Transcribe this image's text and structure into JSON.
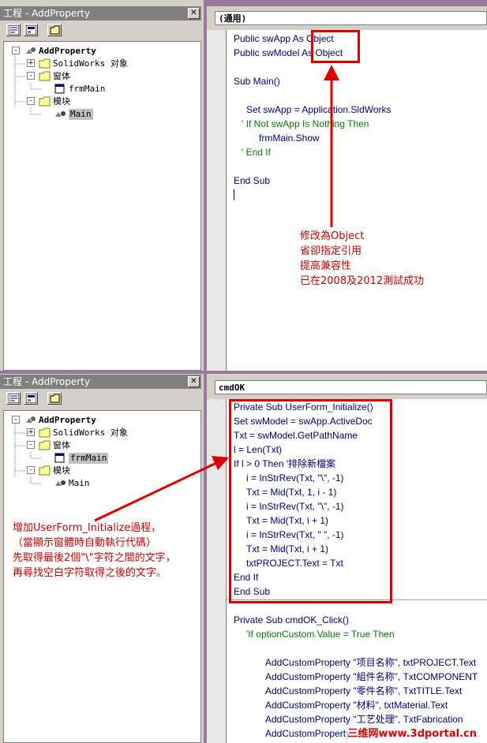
{
  "top": {
    "project_title": "工程 - AddProperty",
    "close_glyph": "✕",
    "combo": "(通用)",
    "tree": [
      {
        "label": "AddProperty",
        "bold": true
      },
      {
        "label": "SolidWorks 对象",
        "expander": "+"
      },
      {
        "label": "窗体",
        "expander": "-"
      },
      {
        "label": "frmMain"
      },
      {
        "label": "模块",
        "expander": "-"
      },
      {
        "label": "Main",
        "selected": true
      }
    ],
    "code": [
      "Public swApp As Object",
      "Public swModel As Object",
      "",
      "Sub Main()",
      "",
      "Set swApp = Application.SldWorks",
      "' If Not swApp Is Nothing Then",
      "frmMain.Show",
      "' End If",
      "",
      "End Sub"
    ],
    "annotation": [
      "修改為Object",
      "省卻指定引用",
      "提高兼容性",
      "已在2008及2012測試成功"
    ]
  },
  "bottom": {
    "project_title": "工程 - AddProperty",
    "close_glyph": "✕",
    "combo": "cmdOK",
    "tree": [
      {
        "label": "AddProperty",
        "bold": true
      },
      {
        "label": "SolidWorks 对象",
        "expander": "+"
      },
      {
        "label": "窗体",
        "expander": "-"
      },
      {
        "label": "frmMain",
        "selected": true
      },
      {
        "label": "模块",
        "expander": "-"
      },
      {
        "label": "Main"
      }
    ],
    "code": [
      "Private Sub UserForm_Initialize()",
      "Set swModel = swApp.ActiveDoc",
      "Txt = swModel.GetPathName",
      "l = Len(Txt)",
      "If l > 0 Then '排除新檔案",
      "i = InStrRev(Txt, \"\\\", -1)",
      "Txt = Mid(Txt, 1, i - 1)",
      "i = InStrRev(Txt, \"\\\", -1)",
      "Txt = Mid(Txt, i + 1)",
      "i = InStrRev(Txt, \" \", -1)",
      "Txt = Mid(Txt, i + 1)",
      "txtPROJECT.Text = Txt",
      "End If",
      "End Sub",
      "",
      "Private Sub cmdOK_Click()",
      "'If optionCustom.Value = True Then",
      "",
      "AddCustomProperty \"项目名称\", txtPROJECT.Text",
      "AddCustomProperty \"組件名称\", TxtCOMPONENT",
      "AddCustomProperty \"零件名称\", TxtTITLE.Text",
      "AddCustomProperty \"材料\", txtMaterial.Text",
      "AddCustomProperty \"工艺处理\", TxtFabrication",
      "AddCustomProperty"
    ],
    "annotation": [
      "增加UserForm_Initialize過程，",
      "（當顯示窗體時自動執行代碼）",
      "先取得最後2個\"\\\"字符之間的文字，",
      "再尋找空白字符取得之後的文字。"
    ]
  },
  "watermark": "三维网www.3dportal.cn",
  "colors": {
    "annotation": "#d40000",
    "keyword": "#000080",
    "comment": "#008000"
  }
}
